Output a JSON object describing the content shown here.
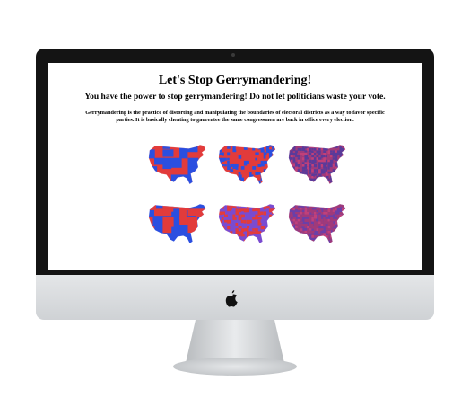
{
  "page": {
    "title": "Let's Stop Gerrymandering!",
    "subtitle": "You have the power to stop gerrymandering! Do not let politicians waste your vote.",
    "description": "Gerrymandering is the practice of distorting and manipulating the boundaries of electoral districts as a way to favor specific parties. It is basically cheating to gaurentee the same congressmen are back in office every election."
  },
  "maps": [
    {
      "style": "blocks",
      "primary": "#e23b3b",
      "secondary": "#2b4fe0"
    },
    {
      "style": "counties",
      "primary": "#e23b3b",
      "secondary": "#2b4fe0"
    },
    {
      "style": "purple",
      "primary": "#a03a7a",
      "secondary": "#5a3a9a"
    },
    {
      "style": "blocks",
      "primary": "#2b4fe0",
      "secondary": "#e23b3b"
    },
    {
      "style": "counties",
      "primary": "#7a4bd0",
      "secondary": "#e23b3b"
    },
    {
      "style": "purple",
      "primary": "#6b3fa8",
      "secondary": "#a03a7a"
    }
  ],
  "colors": {
    "bezel": "#141414",
    "screen": "#ffffff"
  }
}
